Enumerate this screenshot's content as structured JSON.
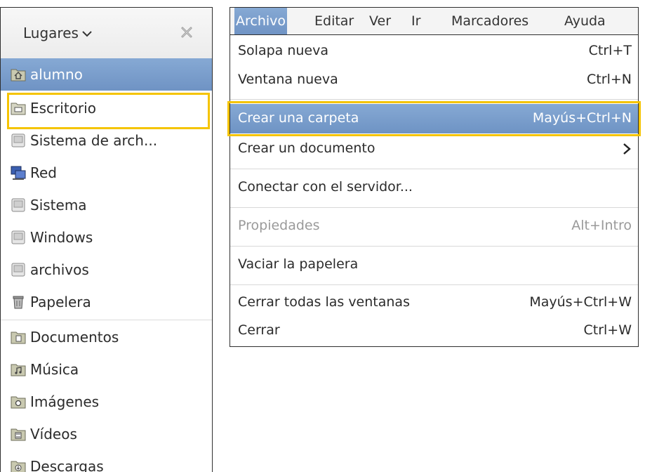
{
  "sidebar": {
    "title": "Lugares",
    "places": [
      {
        "label": "alumno",
        "icon": "home-folder-icon"
      },
      {
        "label": "Escritorio",
        "icon": "desktop-folder-icon"
      },
      {
        "label": "Sistema de arch...",
        "icon": "drive-icon"
      },
      {
        "label": "Red",
        "icon": "network-icon"
      },
      {
        "label": "Sistema",
        "icon": "drive-icon"
      },
      {
        "label": "Windows",
        "icon": "drive-icon"
      },
      {
        "label": "archivos",
        "icon": "drive-icon"
      },
      {
        "label": "Papelera",
        "icon": "trash-icon"
      }
    ],
    "bookmarks": [
      {
        "label": "Documentos",
        "icon": "documents-folder-icon"
      },
      {
        "label": "Música",
        "icon": "music-folder-icon"
      },
      {
        "label": "Imágenes",
        "icon": "pictures-folder-icon"
      },
      {
        "label": "Vídeos",
        "icon": "videos-folder-icon"
      },
      {
        "label": "Descargas",
        "icon": "downloads-folder-icon"
      }
    ]
  },
  "menubar": {
    "items": [
      "Archivo",
      "Editar",
      "Ver",
      "Ir",
      "Marcadores",
      "Ayuda"
    ],
    "active": "Archivo"
  },
  "file_menu": {
    "items": [
      {
        "label": "Solapa nueva",
        "shortcut": "Ctrl+T"
      },
      {
        "label": "Ventana nueva",
        "shortcut": "Ctrl+N"
      },
      {
        "label": "Crear una carpeta",
        "shortcut": "Mayús+Ctrl+N"
      },
      {
        "label": "Crear un documento",
        "shortcut": ""
      },
      {
        "label": "Conectar con el servidor...",
        "shortcut": ""
      },
      {
        "label": "Propiedades",
        "shortcut": "Alt+Intro"
      },
      {
        "label": "Vaciar la papelera",
        "shortcut": ""
      },
      {
        "label": "Cerrar todas las ventanas",
        "shortcut": "Mayús+Ctrl+W"
      },
      {
        "label": "Cerrar",
        "shortcut": "Ctrl+W"
      }
    ]
  },
  "colors": {
    "selection": "#7a9ecc",
    "callout": "#f5c400",
    "disabled_text": "#9a9a9a"
  }
}
